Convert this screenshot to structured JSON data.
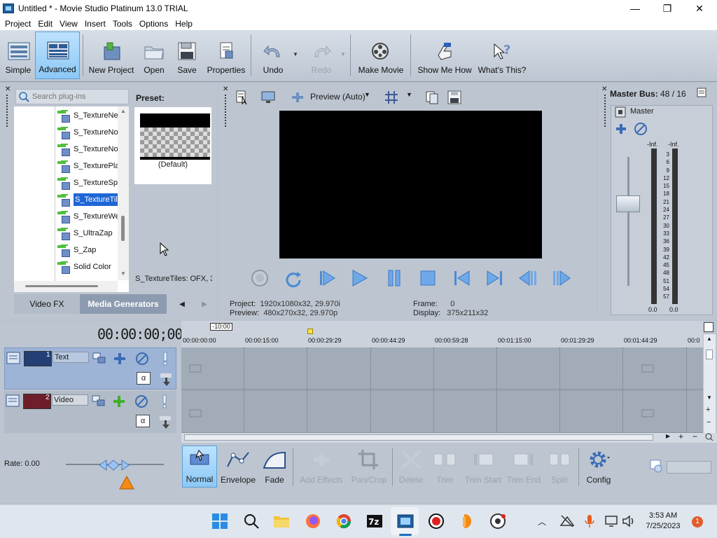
{
  "window": {
    "title": "Untitled * - Movie Studio Platinum 13.0 TRIAL",
    "minimize": "—",
    "maximize": "❐",
    "close": "✕"
  },
  "menu": [
    "Project",
    "Edit",
    "View",
    "Insert",
    "Tools",
    "Options",
    "Help"
  ],
  "toolbar": {
    "simple": "Simple",
    "advanced": "Advanced",
    "new_project": "New Project",
    "open": "Open",
    "save": "Save",
    "properties": "Properties",
    "undo": "Undo",
    "redo": "Redo",
    "make_movie": "Make Movie",
    "show_me_how": "Show Me How",
    "whats_this": "What's This?"
  },
  "plugins": {
    "search_placeholder": "Search plug-ins",
    "items": [
      "S_TextureNe",
      "S_TextureNo",
      "S_TextureNo",
      "S_TexturePla",
      "S_TextureSp",
      "S_TextureTil",
      "S_TextureWe",
      "S_UltraZap",
      "S_Zap",
      "Solid Color"
    ],
    "selected_index": 5,
    "preset_label": "Preset:",
    "preset_name": "(Default)",
    "description": "S_TextureTiles: OFX, 3",
    "tabs": [
      "Video FX",
      "Media Generators"
    ],
    "active_tab": "Media Generators",
    "tab_prev": "◀",
    "tab_next": "▶"
  },
  "preview": {
    "quality": "Preview (Auto)",
    "project_label": "Project:",
    "project_value": "1920x1080x32, 29.970i",
    "preview_label": "Preview:",
    "preview_value": "480x270x32, 29.970p",
    "frame_label": "Frame:",
    "frame_value": "0",
    "display_label": "Display:",
    "display_value": "375x211x32"
  },
  "master": {
    "title": "Master Bus:",
    "count": "48 / 16",
    "name": "Master",
    "inf_left": "-Inf.",
    "inf_right": "-Inf.",
    "scale": [
      "3",
      "6",
      "9",
      "12",
      "15",
      "18",
      "21",
      "24",
      "27",
      "30",
      "33",
      "36",
      "39",
      "42",
      "45",
      "48",
      "51",
      "54",
      "57"
    ],
    "bottom_left": "0.0",
    "bottom_right": "0.0"
  },
  "timeline": {
    "timecode": "00:00:00;00",
    "negative": "-10:00",
    "ticks": [
      "00:00:00:00",
      "00:00:15:00",
      "00:00:29:29",
      "00:00:44:29",
      "00:00:59:28",
      "00:01:15:00",
      "00:01:29:29",
      "00:01:44:29",
      "00:0"
    ],
    "tracks": [
      {
        "number": "1",
        "name": "Text"
      },
      {
        "number": "2",
        "name": "Video"
      }
    ],
    "alpha": "α"
  },
  "edit": {
    "rate": "Rate: 0.00",
    "normal": "Normal",
    "envelope": "Envelope",
    "fade": "Fade",
    "add_effects": "Add Effects",
    "pan_crop": "Pan/Crop",
    "delete": "Delete",
    "trim": "Trim",
    "trim_start": "Trim Start",
    "trim_end": "Trim End",
    "split": "Split",
    "config": "Config"
  },
  "taskbar": {
    "time": "3:53 AM",
    "date": "7/25/2023",
    "badge": "1"
  },
  "colors": {
    "accent": "#1e66d6",
    "panel": "#bcc5d0",
    "active_tool": "#8cc8f5"
  }
}
